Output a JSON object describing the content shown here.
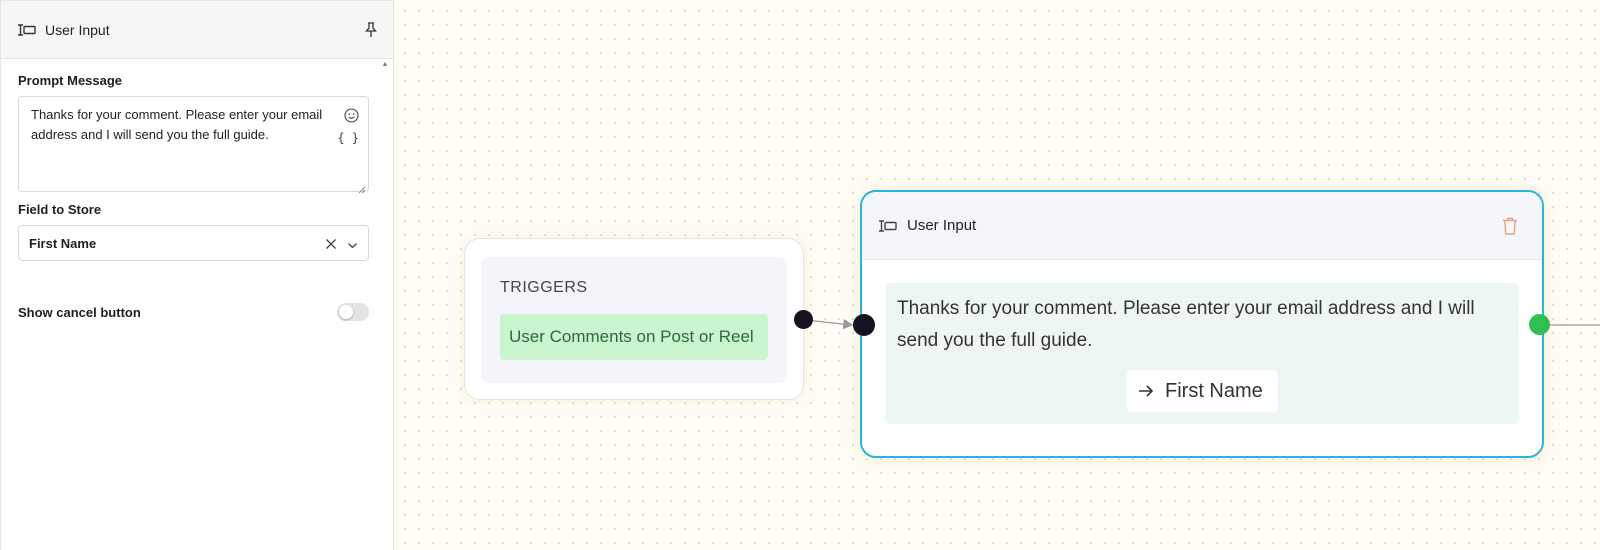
{
  "panel": {
    "title": "User Input",
    "prompt_label": "Prompt Message",
    "prompt_text": "Thanks for your comment. Please enter your email address and I will send you the full guide.",
    "braces_label": "{ }",
    "field_label": "Field to Store",
    "field_value": "First Name",
    "cancel_label": "Show cancel button",
    "cancel_enabled": false
  },
  "canvas": {
    "trigger_node": {
      "title": "TRIGGERS",
      "trigger": "User Comments on Post or Reel"
    },
    "user_node": {
      "title": "User Input",
      "message": "Thanks for your comment. Please enter your email address and I will send you the full guide.",
      "field": "First Name"
    }
  },
  "colors": {
    "accent_border": "#27b6d9",
    "trigger_chip_bg": "#c9f5cf",
    "output_handle": "#2fc052",
    "trash": "#e8a57a"
  }
}
